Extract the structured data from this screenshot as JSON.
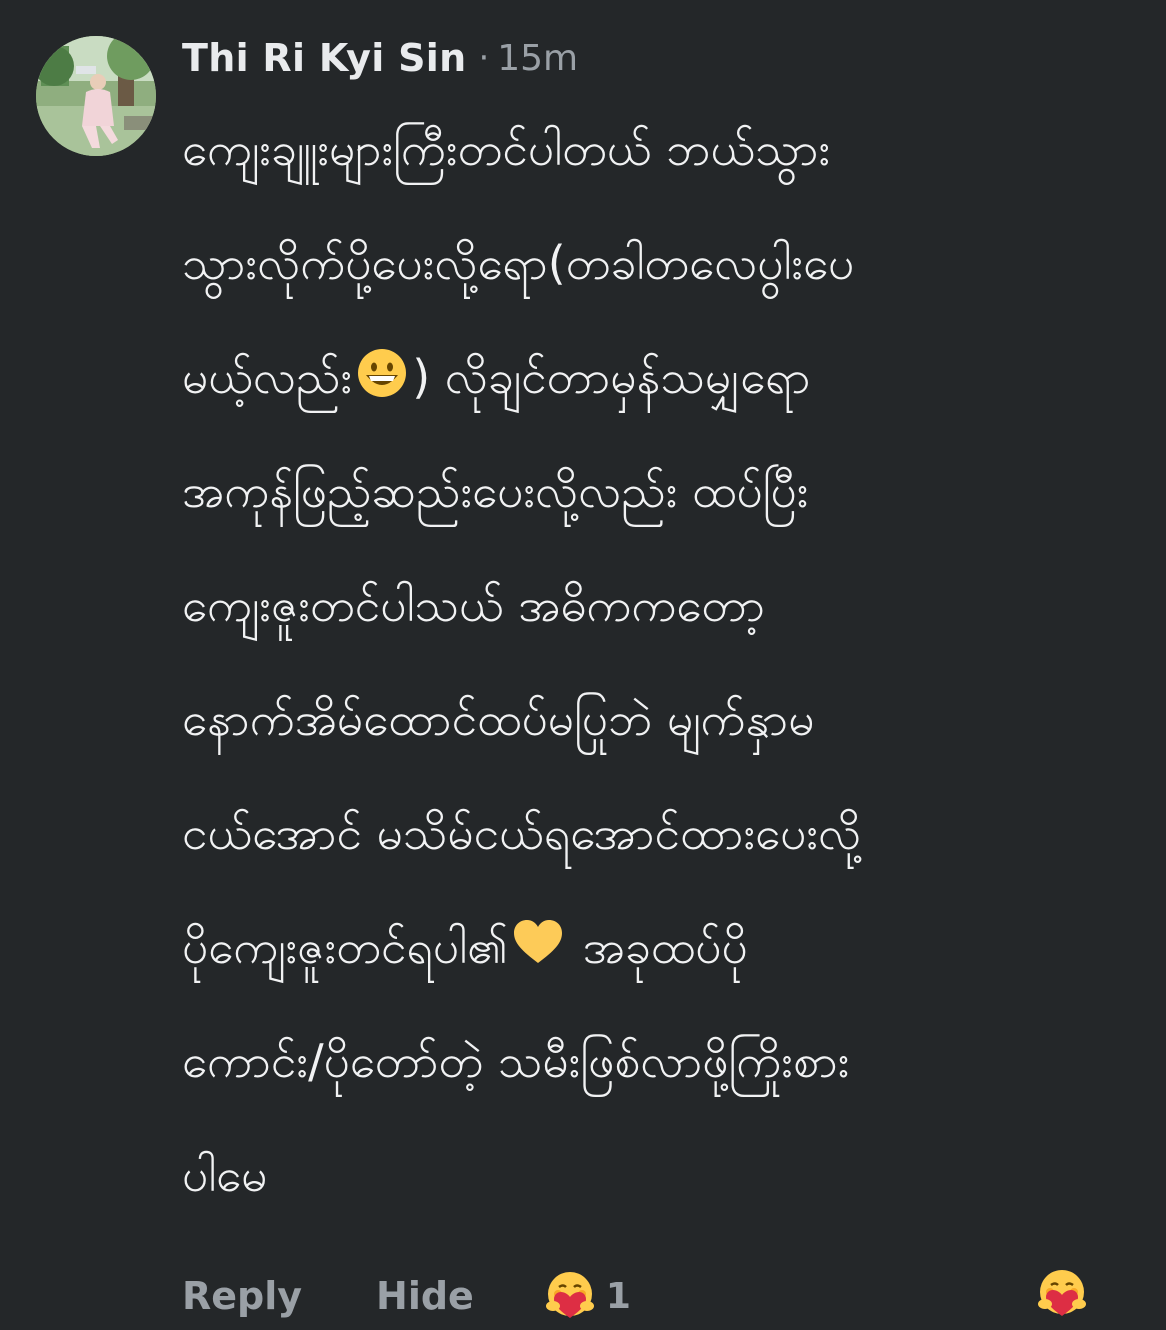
{
  "comment": {
    "author": "Thi Ri Kyi Sin",
    "separator": "·",
    "time": "15m",
    "lines": [
      "ကျေးချူးများကြီးတင်ပါတယ် ဘယ်သွား",
      "သွားလိုက်ပို့ပေးလို့ရော(တခါတလေပွါးပေ",
      "မယ့်လည်း",
      ") လိုချင်တာမှန်သမျှရော",
      "အကုန်ဖြည့်ဆည်းပေးလို့လည်း ထပ်ပြီး",
      "ကျေးဇူးတင်ပါသယ် အဓိကကတော့",
      "နောက်အိမ်ထောင်ထပ်မပြုဘဲ မျက်နှာမ",
      "ငယ်အောင် မသိမ်ငယ်ရအောင်ထားပေးလို့",
      "ပိုကျေးဇူးတင်ရပါ၏",
      " အခုထပ်ပို",
      "ကောင်း/ပိုတော်တဲ့ သမီးဖြစ်လာဖို့ကြိုးစား",
      "ပါမေ"
    ],
    "inline_emojis": [
      "grinning-face-icon",
      "yellow-heart-icon"
    ]
  },
  "actions": {
    "reply_label": "Reply",
    "hide_label": "Hide",
    "reaction_icon": "hugging-heart-face-icon",
    "reaction_count": "1",
    "react_button_icon": "hugging-heart-face-icon"
  },
  "colors": {
    "background": "#242729",
    "text_primary": "#f1f2f3",
    "text_secondary": "#9aa0a6"
  }
}
